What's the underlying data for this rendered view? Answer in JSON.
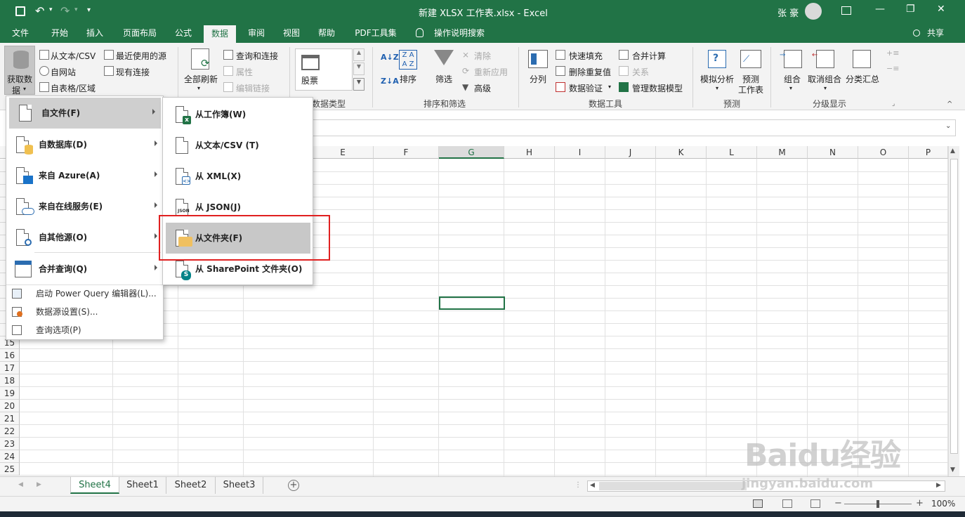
{
  "window": {
    "title": "新建 XLSX 工作表.xlsx  -  Excel",
    "user": "张 豪",
    "controls": [
      "—",
      "❐",
      "✕"
    ]
  },
  "tabs": [
    {
      "label": "文件"
    },
    {
      "label": "开始"
    },
    {
      "label": "插入"
    },
    {
      "label": "页面布局"
    },
    {
      "label": "公式"
    },
    {
      "label": "数据",
      "active": true
    },
    {
      "label": "审阅"
    },
    {
      "label": "视图"
    },
    {
      "label": "帮助"
    },
    {
      "label": "PDF工具集"
    },
    {
      "label": "操作说明搜索"
    }
  ],
  "share_label": "共享",
  "ribbon": {
    "get_data": "获取数",
    "get_data_line2": "据",
    "from_text_csv": "从文本/CSV",
    "from_web": "自网站",
    "from_table": "自表格/区域",
    "recent_sources": "最近使用的源",
    "existing_conn": "现有连接",
    "refresh_all": "全部刷新",
    "queries_conn": "查询和连接",
    "properties": "属性",
    "edit_links": "编辑链接",
    "stocks": "股票",
    "data_types_group": "数据类型",
    "sort": "排序",
    "filter": "筛选",
    "clear": "清除",
    "reapply": "重新应用",
    "advanced": "高级",
    "sort_filter_group": "排序和筛选",
    "text_to_cols": "分列",
    "flash_fill": "快速填充",
    "remove_dup": "删除重复值",
    "data_validation": "数据验证",
    "consolidate": "合并计算",
    "relationships": "关系",
    "manage_model": "管理数据模型",
    "data_tools_group": "数据工具",
    "what_if": "模拟分析",
    "forecast_sheet": "预测",
    "forecast_sheet_line2": "工作表",
    "forecast_group": "预测",
    "group": "组合",
    "ungroup": "取消组合",
    "subtotal": "分类汇总",
    "outline_group": "分级显示"
  },
  "main_menu": {
    "items": [
      {
        "label": "自文件(F)"
      },
      {
        "label": "自数据库(D)"
      },
      {
        "label": "来自 Azure(A)"
      },
      {
        "label": "来自在线服务(E)"
      },
      {
        "label": "自其他源(O)"
      },
      {
        "label": "合并查询(Q)"
      }
    ],
    "simple_items": [
      {
        "label": "启动 Power Query 编辑器(L)..."
      },
      {
        "label": "数据源设置(S)..."
      },
      {
        "label": "查询选项(P)"
      }
    ]
  },
  "sub_menu": {
    "items": [
      {
        "label": "从工作簿(W)"
      },
      {
        "label": "从文本/CSV (T)"
      },
      {
        "label": "从 XML(X)"
      },
      {
        "label": "从 JSON(J)"
      },
      {
        "label": "从文件夹(F)"
      },
      {
        "label": "从 SharePoint 文件夹(O)"
      }
    ]
  },
  "columns": [
    "E",
    "F",
    "G",
    "H",
    "I",
    "J",
    "K",
    "L",
    "M",
    "N",
    "O",
    "P"
  ],
  "rows": [
    "15",
    "16",
    "17",
    "18",
    "19",
    "20",
    "21",
    "22",
    "23",
    "24",
    "25"
  ],
  "sheets": [
    {
      "label": "Sheet4",
      "active": true
    },
    {
      "label": "Sheet1"
    },
    {
      "label": "Sheet2"
    },
    {
      "label": "Sheet3"
    }
  ],
  "zoom": "100%",
  "watermark": {
    "text": "Baidu经验",
    "sub": "jingyan.baidu.com"
  },
  "colors": {
    "accent": "#217346",
    "highlight_box": "#e02020"
  }
}
